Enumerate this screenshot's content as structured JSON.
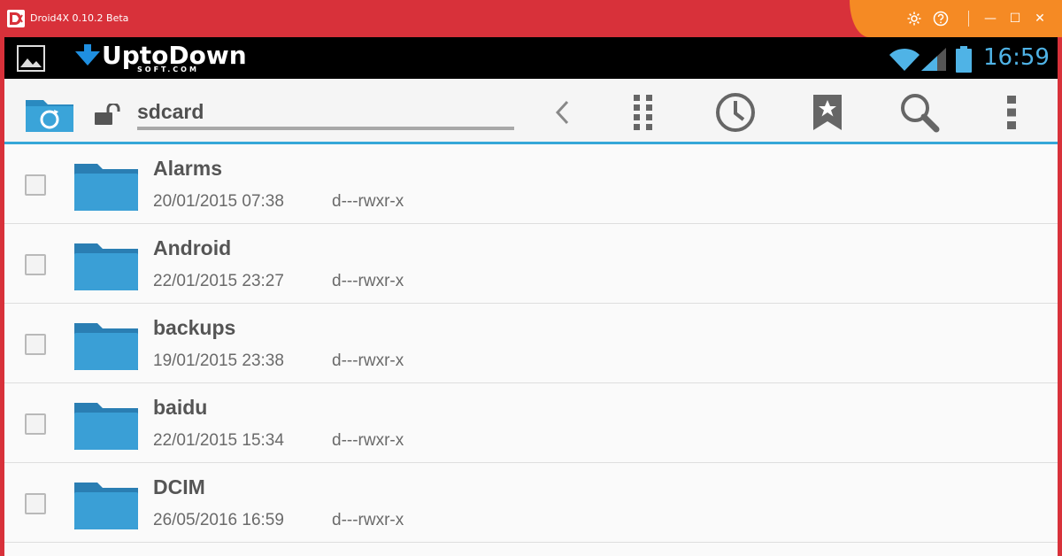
{
  "window": {
    "title": "Droid4X 0.10.2 Beta",
    "controls": {
      "settings_icon": "gear-icon",
      "help_icon": "question-icon",
      "minimize_glyph": "—",
      "maximize_glyph": "☐",
      "close_glyph": "✕"
    },
    "colors": {
      "titlebar": "#d8313a",
      "accent": "#f58a24"
    }
  },
  "statusbar": {
    "brand_name": "UptoDown",
    "brand_sub": "SOFT.COM",
    "time": "16:59",
    "colors": {
      "time": "#4fb3e6"
    }
  },
  "toolbar": {
    "path": "sdcard",
    "icons": [
      "folder-refresh-icon",
      "lock-icon",
      "back-chevron-icon",
      "grid-dots-icon",
      "history-clock-icon",
      "bookmark-star-icon",
      "search-icon",
      "overflow-menu-icon"
    ],
    "colors": {
      "underline": "#35a7d8"
    }
  },
  "files": [
    {
      "name": "Alarms",
      "date": "20/01/2015 07:38",
      "perm": "d---rwxr-x"
    },
    {
      "name": "Android",
      "date": "22/01/2015 23:27",
      "perm": "d---rwxr-x"
    },
    {
      "name": "backups",
      "date": "19/01/2015 23:38",
      "perm": "d---rwxr-x"
    },
    {
      "name": "baidu",
      "date": "22/01/2015 15:34",
      "perm": "d---rwxr-x"
    },
    {
      "name": "DCIM",
      "date": "26/05/2016 16:59",
      "perm": "d---rwxr-x"
    }
  ]
}
